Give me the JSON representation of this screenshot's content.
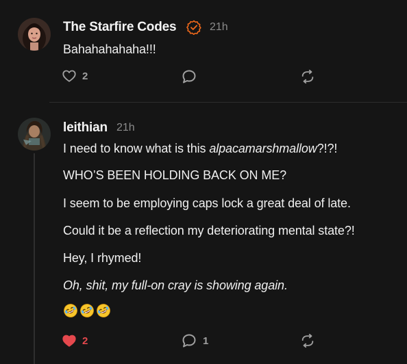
{
  "comments": [
    {
      "author": "The Starfire Codes",
      "time": "21h",
      "verified": true,
      "text": "Bahahahahaha!!!",
      "likes": "2",
      "liked": false,
      "replies": ""
    },
    {
      "author": "leithian",
      "time": "21h",
      "verified": false,
      "lines": {
        "l1_prefix": "I need to know what is this ",
        "l1_italic": "alpacamarshmallow",
        "l1_suffix": "?!?!",
        "l2": "WHO’S BEEN HOLDING BACK ON ME?",
        "l3": "I seem to be employing caps lock a great deal of late.",
        "l4": "Could it be a reflection my deteriorating mental state?!",
        "l5": "Hey, I rhymed!",
        "l6": "Oh, shit, my full-on cray is showing again."
      },
      "emoji_count": 3,
      "likes": "2",
      "liked": true,
      "replies": "1"
    }
  ],
  "colors": {
    "accent_orange": "#f26a1b",
    "like_red": "#e5484d",
    "muted": "#a0a0a0"
  },
  "icons": {
    "verified": "check-circle-icon",
    "like": "heart-icon",
    "reply": "speech-bubble-icon",
    "restack": "restack-icon",
    "emoji": "rolling-laughing-emoji"
  }
}
